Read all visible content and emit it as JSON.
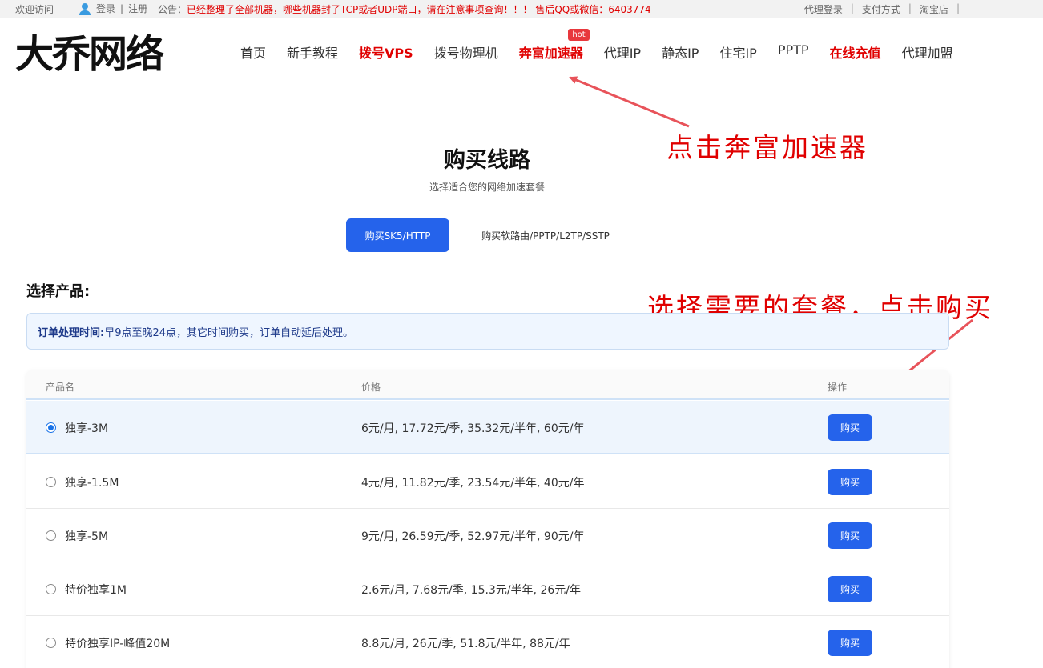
{
  "topbar": {
    "welcome": "欢迎访问",
    "login": "登录",
    "separator": "|",
    "register": "注册",
    "notice_label": "公告：",
    "notice_text": "已经整理了全部机器，哪些机器封了TCP或者UDP端口，请在注意事项查询！！！ 售后QQ或微信：6403774",
    "right_links": [
      "代理登录",
      "支付方式",
      "淘宝店"
    ]
  },
  "logo": "大乔网络",
  "nav": {
    "items": [
      {
        "label": "首页",
        "highlight": false
      },
      {
        "label": "新手教程",
        "highlight": false
      },
      {
        "label": "拨号VPS",
        "highlight": true
      },
      {
        "label": "拨号物理机",
        "highlight": false
      },
      {
        "label": "奔富加速器",
        "highlight": true,
        "badge": "hot"
      },
      {
        "label": "代理IP",
        "highlight": false
      },
      {
        "label": "静态IP",
        "highlight": false
      },
      {
        "label": "住宅IP",
        "highlight": false
      },
      {
        "label": "PPTP",
        "highlight": false
      },
      {
        "label": "在线充值",
        "highlight": true
      },
      {
        "label": "代理加盟",
        "highlight": false
      }
    ]
  },
  "annotations": {
    "step1": "点击奔富加速器",
    "step2": "选择需要的套餐，点击购买"
  },
  "hero": {
    "title": "购买线路",
    "subtitle": "选择适合您的网络加速套餐"
  },
  "tabs": {
    "active": "购买SK5/HTTP",
    "inactive": "购买软路由/PPTP/L2TP/SSTP"
  },
  "section_title": "选择产品:",
  "info": {
    "label": "订单处理时间:",
    "text": "早9点至晚24点，其它时间购买，订单自动延后处理。"
  },
  "table": {
    "headers": {
      "name": "产品名",
      "price": "价格",
      "action": "操作"
    },
    "rows": [
      {
        "name": "独享-3M",
        "price": "6元/月, 17.72元/季, 35.32元/半年, 60元/年",
        "button": "购买",
        "selected": true
      },
      {
        "name": "独享-1.5M",
        "price": "4元/月, 11.82元/季, 23.54元/半年, 40元/年",
        "button": "购买",
        "selected": false
      },
      {
        "name": "独享-5M",
        "price": "9元/月, 26.59元/季, 52.97元/半年, 90元/年",
        "button": "购买",
        "selected": false
      },
      {
        "name": "特价独享1M",
        "price": "2.6元/月, 7.68元/季, 15.3元/半年, 26元/年",
        "button": "购买",
        "selected": false
      },
      {
        "name": "特价独享IP-峰值20M",
        "price": "8.8元/月, 26元/季, 51.8元/半年, 88元/年",
        "button": "购买",
        "selected": false
      }
    ]
  },
  "colors": {
    "accent": "#2563eb",
    "highlight_red": "#e00000",
    "annotation_red": "#e00000"
  }
}
